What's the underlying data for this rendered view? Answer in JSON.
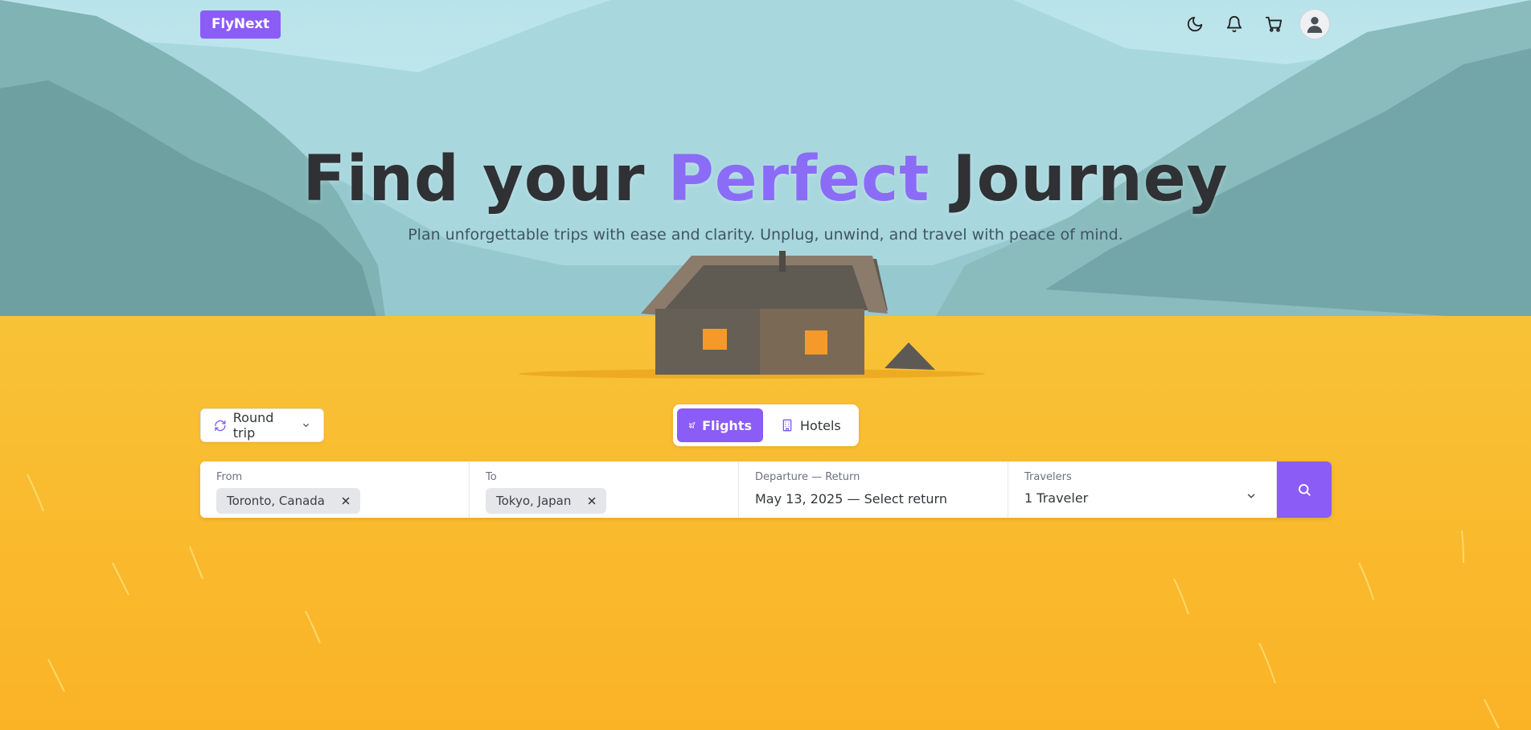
{
  "app": {
    "logo": "FlyNext"
  },
  "header": {
    "icons": [
      "moon-icon",
      "bell-icon",
      "cart-icon",
      "user-avatar-icon"
    ]
  },
  "hero": {
    "title_before": "Find your ",
    "title_accent": "Perfect",
    "title_after": " Journey",
    "subtitle": "Plan unforgettable trips with ease and clarity. Unplug, unwind, and travel with peace of mind."
  },
  "trip_type": {
    "label": "Round trip"
  },
  "tabs": [
    {
      "label": "Flights",
      "active": true,
      "icon": "plane-icon"
    },
    {
      "label": "Hotels",
      "active": false,
      "icon": "building-icon"
    }
  ],
  "search": {
    "from": {
      "label": "From",
      "value": "Toronto, Canada"
    },
    "to": {
      "label": "To",
      "value": "Tokyo, Japan"
    },
    "dates": {
      "label": "Departure — Return",
      "value": "May 13, 2025 — Select return"
    },
    "travelers": {
      "label": "Travelers",
      "value": "1 Traveler"
    }
  },
  "colors": {
    "accent": "#8b5cf6",
    "sky": "#bfe3ea",
    "field": "#f9b729"
  }
}
